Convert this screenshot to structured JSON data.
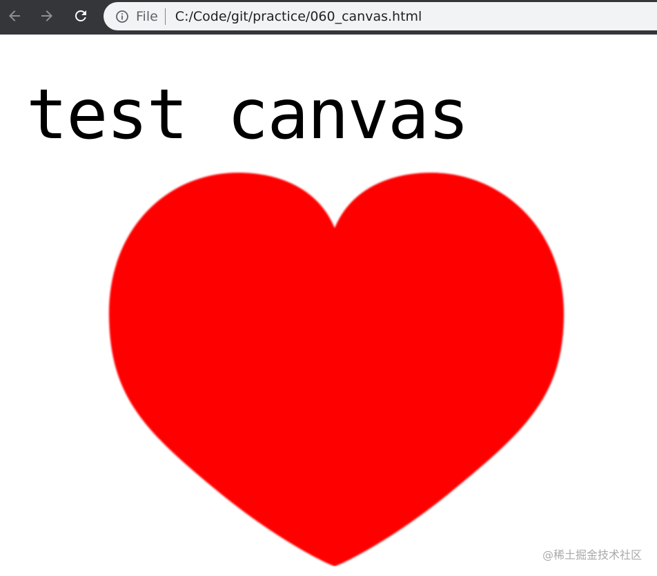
{
  "browser": {
    "nav": {
      "back_icon": "arrow-left-icon",
      "forward_icon": "arrow-right-icon",
      "reload_icon": "reload-icon"
    },
    "omnibox": {
      "info_icon": "info-icon",
      "scheme_label": "File",
      "url": "C:/Code/git/practice/060_canvas.html"
    },
    "colors": {
      "toolbar": "#35363a",
      "omnibox_bg": "#f1f3f4"
    }
  },
  "page": {
    "title_text": "test canvas",
    "heart_color": "#ff0000",
    "heart_icon": "heart-icon",
    "watermark": "@稀土掘金技术社区"
  }
}
